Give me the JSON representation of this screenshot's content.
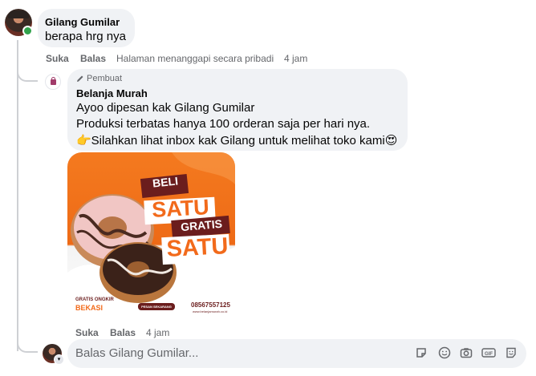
{
  "comment": {
    "author": "Gilang Gumilar",
    "text": "berapa hrg nya",
    "actions": {
      "like": "Suka",
      "reply": "Balas",
      "note": "Halaman menanggapi secara pribadi",
      "time": "4 jam"
    }
  },
  "reply": {
    "badge": "Pembuat",
    "author": "Belanja Murah",
    "lines": [
      "Ayoo dipesan kak Gilang Gumilar",
      "Produksi terbatas hanya 100 orderan saja per hari nya.",
      "👉Silahkan lihat inbox kak Gilang untuk melihat toko kami😍"
    ],
    "image_text": {
      "line1": "BELI",
      "line2": "SATU",
      "line3": "GRATIS",
      "line4": "SATU",
      "footer_left": "GRATIS ONGKIR",
      "footer_left2": "BEKASI",
      "footer_button": "PESAN SEKARANG",
      "footer_phone": "08567557125",
      "footer_small": "www.belanjamurah.co.id"
    },
    "actions": {
      "like": "Suka",
      "reply": "Balas",
      "time": "4 jam"
    }
  },
  "reply_input": {
    "placeholder": "Balas Gilang Gumilar..."
  },
  "icons": [
    "sticker-icon",
    "emoji-icon",
    "camera-icon",
    "gif-icon",
    "avatar-sticker-icon",
    "pencil-icon",
    "shopping-bag-icon"
  ],
  "colors": {
    "bubble": "#f0f2f5",
    "meta_text": "#65676b",
    "online": "#31a24c",
    "poster_orange": "#f47a1f",
    "poster_maroon": "#6b1d1d"
  }
}
